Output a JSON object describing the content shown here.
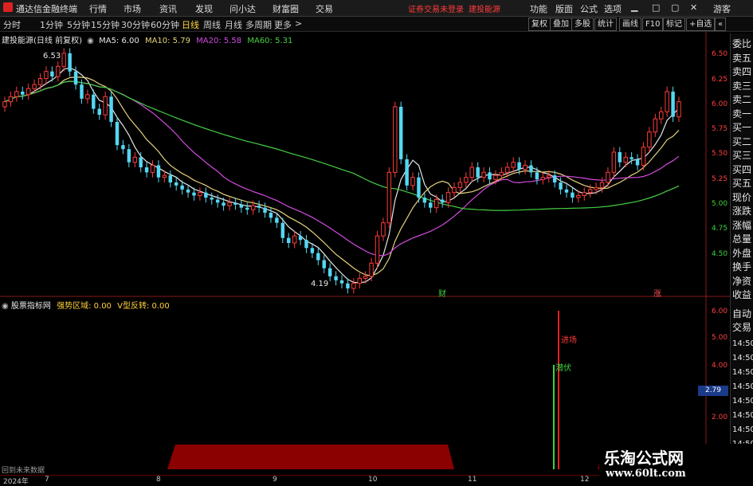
{
  "menubar": {
    "app_title": "通达信金融终端",
    "menus": [
      "行情",
      "市场",
      "资讯",
      "发现",
      "问小达",
      "财富圈",
      "交易"
    ],
    "notice": "证券交易未登录",
    "stock_label": "建投能源",
    "right_menus": [
      "功能",
      "版面",
      "公式",
      "选项"
    ],
    "guest": "游客"
  },
  "periods": [
    "分时",
    "1分钟",
    "5分钟",
    "15分钟",
    "30分钟",
    "60分钟",
    "日线",
    "周线",
    "月线",
    "多周期",
    "更多"
  ],
  "active_period": "日线",
  "tools": [
    "复权",
    "叠加",
    "多股",
    "统计",
    "画线",
    "F10",
    "标记",
    "+自选"
  ],
  "main": {
    "stock_info": "建投能源(日线 前复权)",
    "ma": [
      {
        "label": "MA5: 6.00",
        "color": "#e6e6e6"
      },
      {
        "label": "MA10: 5.79",
        "color": "#e6d27a"
      },
      {
        "label": "MA20: 5.58",
        "color": "#d24be0"
      },
      {
        "label": "MA60: 5.31",
        "color": "#44d044"
      }
    ],
    "price_ticks": [
      "6.50",
      "6.25",
      "6.00",
      "5.75",
      "5.50",
      "5.25",
      "5.00",
      "4.75",
      "4.50"
    ],
    "high_label": "6.53",
    "low_label": "4.19",
    "marker_cai": "财",
    "marker_zhang": "涨"
  },
  "chart_data": {
    "type": "candlestick",
    "ylim": [
      4.2,
      6.6
    ],
    "closes": [
      6.05,
      6.1,
      6.15,
      6.12,
      6.18,
      6.22,
      6.28,
      6.35,
      6.3,
      6.4,
      6.53,
      6.35,
      6.22,
      6.08,
      6.12,
      5.98,
      5.92,
      6.1,
      5.85,
      5.62,
      5.58,
      5.45,
      5.5,
      5.4,
      5.35,
      5.42,
      5.3,
      5.32,
      5.25,
      5.22,
      5.18,
      5.15,
      5.12,
      5.15,
      5.1,
      5.08,
      5.05,
      5.02,
      5.05,
      5.03,
      5.0,
      4.98,
      5.02,
      5.0,
      4.95,
      4.9,
      4.85,
      4.7,
      4.65,
      4.72,
      4.68,
      4.6,
      4.55,
      4.48,
      4.4,
      4.32,
      4.28,
      4.25,
      4.2,
      4.25,
      4.3,
      4.32,
      4.45,
      4.72,
      4.85,
      5.35,
      6.0,
      5.48,
      5.22,
      5.3,
      5.1,
      5.05,
      5.0,
      5.08,
      5.05,
      5.15,
      5.2,
      5.25,
      5.3,
      5.4,
      5.3,
      5.35,
      5.28,
      5.32,
      5.35,
      5.4,
      5.45,
      5.38,
      5.42,
      5.35,
      5.28,
      5.3,
      5.32,
      5.25,
      5.18,
      5.15,
      5.1,
      5.12,
      5.15,
      5.18,
      5.2,
      5.25,
      5.35,
      5.55,
      5.45,
      5.5,
      5.48,
      5.42,
      5.6,
      5.75,
      5.88,
      5.95,
      6.15,
      5.9,
      6.05
    ]
  },
  "sub": {
    "title": "股票指标网",
    "items": [
      {
        "label": "强势区域: 0.00",
        "color": "#ffd23a"
      },
      {
        "label": "V型反转: 0.00",
        "color": "#ffd23a"
      }
    ],
    "ticks": [
      "6.00",
      "5.00",
      "4.00",
      "3.00",
      "2.00"
    ],
    "current_value": "2.79",
    "signal_in": "进场",
    "signal_dip": "潜伏",
    "bottom_note": "回到未来数据"
  },
  "side_panel": {
    "top": [
      "委比",
      "卖五",
      "卖四",
      "卖三",
      "卖二",
      "卖一",
      "买一",
      "买二",
      "买三",
      "买四",
      "买五",
      "现价",
      "涨跌",
      "涨幅",
      "总量",
      "外盘",
      "换手",
      "净资",
      "收益"
    ],
    "mid": [
      "自动",
      "交易"
    ],
    "times": [
      "14:50",
      "14:50",
      "14:50",
      "14:50",
      "14:50",
      "14:50",
      "14:50",
      "14:50",
      "14:50"
    ]
  },
  "date_axis": [
    "2024年",
    "7",
    "8",
    "9",
    "10",
    "11",
    "12"
  ],
  "watermark": {
    "title": "乐淘公式网",
    "url": "www.60lt.com"
  }
}
